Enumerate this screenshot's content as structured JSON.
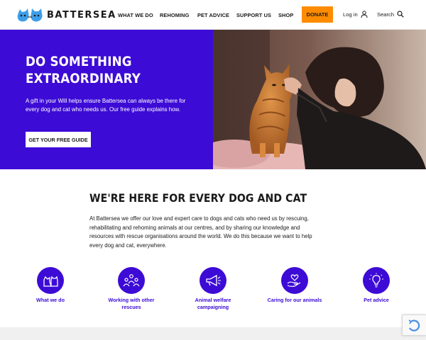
{
  "header": {
    "logo_text": "BATTERSEA",
    "nav": [
      {
        "label": "WHAT WE DO"
      },
      {
        "label": "REHOMING"
      },
      {
        "label": "PET ADVICE"
      },
      {
        "label": "SUPPORT US"
      },
      {
        "label": "SHOP"
      }
    ],
    "donate_label": "DONATE",
    "login_label": "Log in",
    "login_icon": "user-icon",
    "search_label": "Search",
    "search_icon": "search-icon"
  },
  "hero": {
    "title_line1": "DO SOMETHING",
    "title_line2": "EXTRAORDINARY",
    "text": "A gift in your Will helps ensure Battersea can always be there for every dog and cat who needs us. Our free guide explains how.",
    "button_label": "GET YOUR FREE GUIDE",
    "accent_color": "#3d0bd6"
  },
  "intro": {
    "title": "WE'RE HERE FOR EVERY DOG AND CAT",
    "text": "At Battersea we offer our love and expert care to dogs and cats who need us by rescuing, rehabilitating and rehoming animals at our centres, and by sharing our knowledge and resources with rescue organisations around the world. We do this because we want to help every dog and cat, everywhere."
  },
  "features": [
    {
      "label": "What we do",
      "icon": "dog-cat-icon"
    },
    {
      "label": "Working with other rescues",
      "icon": "people-group-icon"
    },
    {
      "label": "Animal welfare campaigning",
      "icon": "megaphone-icon"
    },
    {
      "label": "Caring for our animals",
      "icon": "heart-hand-icon"
    },
    {
      "label": "Pet advice",
      "icon": "lightbulb-icon"
    }
  ],
  "colors": {
    "brand_purple": "#3d0bd6",
    "donate_orange": "#ff8c00"
  }
}
